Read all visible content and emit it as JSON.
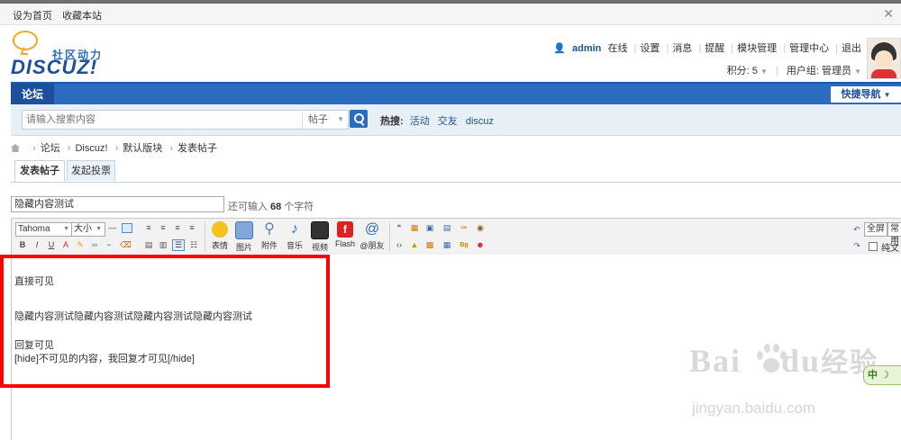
{
  "top_links": [
    "设为首页",
    "收藏本站"
  ],
  "logo": {
    "tagline": "社区动力",
    "word": "DISCUZ!"
  },
  "user": {
    "name": "admin",
    "status": "在线",
    "links": [
      "设置",
      "消息",
      "提醒",
      "模块管理",
      "管理中心",
      "退出"
    ],
    "points": "积分: 5",
    "group": "用户组: 管理员"
  },
  "nav": {
    "tab": "论坛",
    "quick": "快捷导航"
  },
  "search": {
    "placeholder": "请输入搜索内容",
    "type": "帖子",
    "hot_label": "热搜:",
    "hot_keywords": [
      "活动",
      "交友",
      "discuz"
    ]
  },
  "breadcrumb": [
    "论坛",
    "Discuz!",
    "默认版块",
    "发表帖子"
  ],
  "tabs": [
    "发表帖子",
    "发起投票"
  ],
  "post": {
    "title": "隐藏内容测试",
    "remaining_prefix": "还可输入",
    "remaining_count": "68",
    "remaining_suffix": "个字符"
  },
  "toolbar": {
    "font": "Tahoma",
    "size": "大小",
    "big_buttons": [
      "表情",
      "图片",
      "附件",
      "音乐",
      "视频",
      "Flash",
      "@朋友"
    ],
    "fullscreen": "全屏",
    "normal": "常用",
    "plain": "纯文本"
  },
  "editor": {
    "lines": [
      "直接可见",
      "",
      "隐藏内容测试隐藏内容测试隐藏内容测试隐藏内容测试",
      "",
      "回复可见",
      "[hide]不可见的内容，我回复才可见[/hide]"
    ]
  },
  "watermark": {
    "brand": "Bai",
    "brand2": "du",
    "cn": "经验",
    "url": "jingyan.baidu.com",
    "ime": "中"
  },
  "colors": {
    "nav_blue": "#2b6cbf",
    "highlight_red": "#ff0000",
    "link_blue": "#1e5494"
  }
}
